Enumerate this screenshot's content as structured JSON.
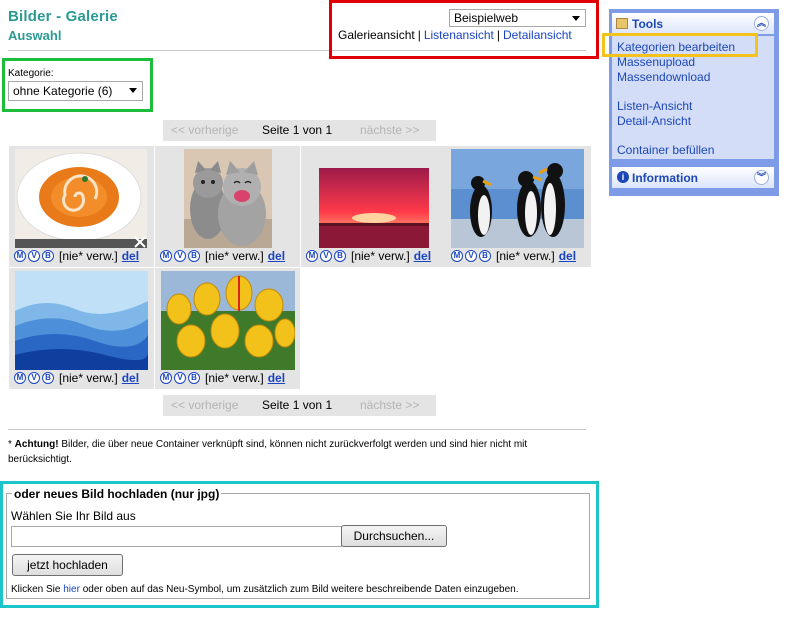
{
  "header": {
    "title": "Bilder - Galerie",
    "subtitle": "Auswahl"
  },
  "web_select": {
    "value": "Beispielweb"
  },
  "view_links": [
    "Galerieansicht",
    "Listenansicht",
    "Detailansicht"
  ],
  "category": {
    "label": "Kategorie:",
    "value": "ohne Kategorie (6)"
  },
  "pager": {
    "prev": "<< vorherige",
    "page_word": "Seite",
    "current": "1",
    "of_word": "von",
    "total": "1",
    "next": "nächste >>"
  },
  "gallery": {
    "action_icons": [
      "M",
      "V",
      "B"
    ],
    "items": [
      {
        "name": "soup",
        "usage": "[nie* verw.]",
        "delete": "del"
      },
      {
        "name": "cats",
        "usage": "[nie* verw.]",
        "delete": "del"
      },
      {
        "name": "sunset",
        "usage": "[nie* verw.]",
        "delete": "del"
      },
      {
        "name": "penguins",
        "usage": "[nie* verw.]",
        "delete": "del"
      },
      {
        "name": "blue-hills",
        "usage": "[nie* verw.]",
        "delete": "del"
      },
      {
        "name": "tulips",
        "usage": "[nie* verw.]",
        "delete": "del"
      }
    ]
  },
  "note": {
    "prefix": "* ",
    "bold": "Achtung!",
    "text": " Bilder, die über neue Container verknüpft sind, können nicht zurückverfolgt werden und sind hier nicht mit berücksichtigt."
  },
  "upload": {
    "legend": "oder neues Bild hochladen (nur jpg)",
    "choose_label": "Wählen Sie Ihr Bild aus",
    "browse_button": "Durchsuchen...",
    "upload_button": "jetzt hochladen",
    "hint_before": "Klicken Sie ",
    "hint_link": "hier",
    "hint_after": " oder oben auf das Neu-Symbol, um zusätzlich zum Bild weitere beschreibende Daten einzugeben."
  },
  "sidebar": {
    "tools_title": "Tools",
    "tools_items": [
      "Kategorien bearbeiten",
      "Massenupload",
      "Massendownload",
      "Listen-Ansicht",
      "Detail-Ansicht",
      "Container befüllen"
    ],
    "info_title": "Information"
  },
  "colors": {
    "accent_teal": "#2b9a93",
    "link_blue": "#1a44c2",
    "highlight_red": "#e00000",
    "highlight_green": "#1bbd3a",
    "highlight_cyan": "#1cc5c8",
    "highlight_yellow": "#f5c11b",
    "sidebar_blue": "#7d9be6"
  }
}
